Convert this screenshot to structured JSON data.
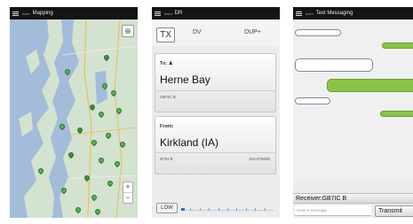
{
  "screens": {
    "mapping": {
      "title": "Mapping",
      "tag": "Icom"
    },
    "dr": {
      "title": "DR",
      "tag": "Icom",
      "tx_label": "TX",
      "mode": "DV",
      "duplex": "DUP+",
      "to": {
        "label": "To:",
        "name": "Herne Bay",
        "callsign": "GB7IC B"
      },
      "from": {
        "label": "From:",
        "name": "Kirkland (IA)",
        "callsign": "N7IH B",
        "frequency": "443.575000"
      },
      "power_label": "LOW",
      "meter_level": 0.04
    },
    "text_messaging": {
      "title": "Text Messaging",
      "tag": "Icom",
      "receiver": "Receiver:GB7IC B",
      "input_placeholder": "Enter a message",
      "transmit_label": "Transmit"
    }
  },
  "colors": {
    "status_bar": "#141414",
    "water": "#9fb9d8",
    "land": "#cfe0cf",
    "outgoing_bubble": "#8bc34a",
    "incoming_border": "#7c8aa0"
  },
  "icons": [
    "menu-icon",
    "person-icon",
    "locate-icon",
    "map-pin-icon"
  ]
}
